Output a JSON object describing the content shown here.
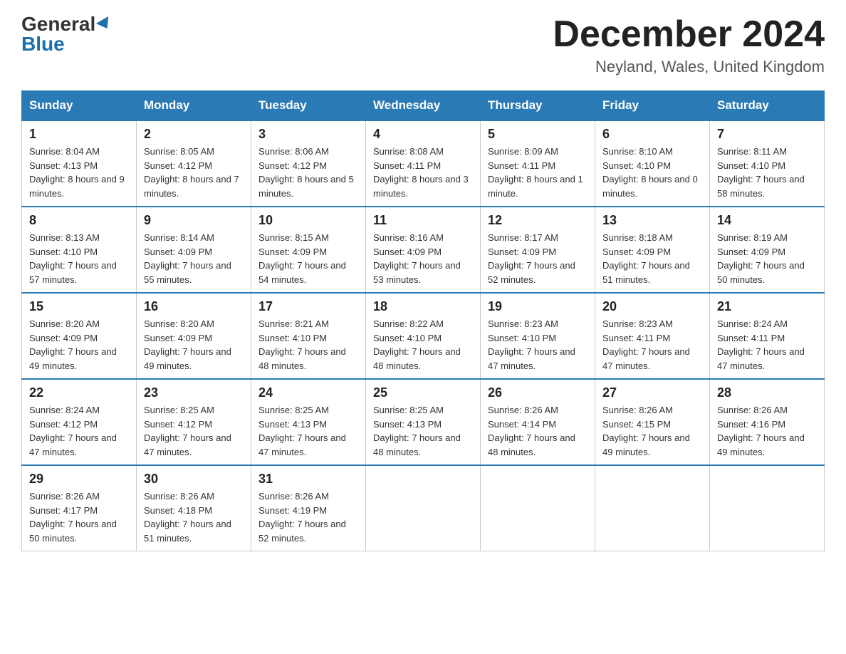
{
  "header": {
    "logo_general": "General",
    "logo_blue": "Blue",
    "month_title": "December 2024",
    "location": "Neyland, Wales, United Kingdom"
  },
  "weekdays": [
    "Sunday",
    "Monday",
    "Tuesday",
    "Wednesday",
    "Thursday",
    "Friday",
    "Saturday"
  ],
  "weeks": [
    [
      {
        "day": "1",
        "sunrise": "8:04 AM",
        "sunset": "4:13 PM",
        "daylight": "8 hours and 9 minutes."
      },
      {
        "day": "2",
        "sunrise": "8:05 AM",
        "sunset": "4:12 PM",
        "daylight": "8 hours and 7 minutes."
      },
      {
        "day": "3",
        "sunrise": "8:06 AM",
        "sunset": "4:12 PM",
        "daylight": "8 hours and 5 minutes."
      },
      {
        "day": "4",
        "sunrise": "8:08 AM",
        "sunset": "4:11 PM",
        "daylight": "8 hours and 3 minutes."
      },
      {
        "day": "5",
        "sunrise": "8:09 AM",
        "sunset": "4:11 PM",
        "daylight": "8 hours and 1 minute."
      },
      {
        "day": "6",
        "sunrise": "8:10 AM",
        "sunset": "4:10 PM",
        "daylight": "8 hours and 0 minutes."
      },
      {
        "day": "7",
        "sunrise": "8:11 AM",
        "sunset": "4:10 PM",
        "daylight": "7 hours and 58 minutes."
      }
    ],
    [
      {
        "day": "8",
        "sunrise": "8:13 AM",
        "sunset": "4:10 PM",
        "daylight": "7 hours and 57 minutes."
      },
      {
        "day": "9",
        "sunrise": "8:14 AM",
        "sunset": "4:09 PM",
        "daylight": "7 hours and 55 minutes."
      },
      {
        "day": "10",
        "sunrise": "8:15 AM",
        "sunset": "4:09 PM",
        "daylight": "7 hours and 54 minutes."
      },
      {
        "day": "11",
        "sunrise": "8:16 AM",
        "sunset": "4:09 PM",
        "daylight": "7 hours and 53 minutes."
      },
      {
        "day": "12",
        "sunrise": "8:17 AM",
        "sunset": "4:09 PM",
        "daylight": "7 hours and 52 minutes."
      },
      {
        "day": "13",
        "sunrise": "8:18 AM",
        "sunset": "4:09 PM",
        "daylight": "7 hours and 51 minutes."
      },
      {
        "day": "14",
        "sunrise": "8:19 AM",
        "sunset": "4:09 PM",
        "daylight": "7 hours and 50 minutes."
      }
    ],
    [
      {
        "day": "15",
        "sunrise": "8:20 AM",
        "sunset": "4:09 PM",
        "daylight": "7 hours and 49 minutes."
      },
      {
        "day": "16",
        "sunrise": "8:20 AM",
        "sunset": "4:09 PM",
        "daylight": "7 hours and 49 minutes."
      },
      {
        "day": "17",
        "sunrise": "8:21 AM",
        "sunset": "4:10 PM",
        "daylight": "7 hours and 48 minutes."
      },
      {
        "day": "18",
        "sunrise": "8:22 AM",
        "sunset": "4:10 PM",
        "daylight": "7 hours and 48 minutes."
      },
      {
        "day": "19",
        "sunrise": "8:23 AM",
        "sunset": "4:10 PM",
        "daylight": "7 hours and 47 minutes."
      },
      {
        "day": "20",
        "sunrise": "8:23 AM",
        "sunset": "4:11 PM",
        "daylight": "7 hours and 47 minutes."
      },
      {
        "day": "21",
        "sunrise": "8:24 AM",
        "sunset": "4:11 PM",
        "daylight": "7 hours and 47 minutes."
      }
    ],
    [
      {
        "day": "22",
        "sunrise": "8:24 AM",
        "sunset": "4:12 PM",
        "daylight": "7 hours and 47 minutes."
      },
      {
        "day": "23",
        "sunrise": "8:25 AM",
        "sunset": "4:12 PM",
        "daylight": "7 hours and 47 minutes."
      },
      {
        "day": "24",
        "sunrise": "8:25 AM",
        "sunset": "4:13 PM",
        "daylight": "7 hours and 47 minutes."
      },
      {
        "day": "25",
        "sunrise": "8:25 AM",
        "sunset": "4:13 PM",
        "daylight": "7 hours and 48 minutes."
      },
      {
        "day": "26",
        "sunrise": "8:26 AM",
        "sunset": "4:14 PM",
        "daylight": "7 hours and 48 minutes."
      },
      {
        "day": "27",
        "sunrise": "8:26 AM",
        "sunset": "4:15 PM",
        "daylight": "7 hours and 49 minutes."
      },
      {
        "day": "28",
        "sunrise": "8:26 AM",
        "sunset": "4:16 PM",
        "daylight": "7 hours and 49 minutes."
      }
    ],
    [
      {
        "day": "29",
        "sunrise": "8:26 AM",
        "sunset": "4:17 PM",
        "daylight": "7 hours and 50 minutes."
      },
      {
        "day": "30",
        "sunrise": "8:26 AM",
        "sunset": "4:18 PM",
        "daylight": "7 hours and 51 minutes."
      },
      {
        "day": "31",
        "sunrise": "8:26 AM",
        "sunset": "4:19 PM",
        "daylight": "7 hours and 52 minutes."
      },
      null,
      null,
      null,
      null
    ]
  ]
}
